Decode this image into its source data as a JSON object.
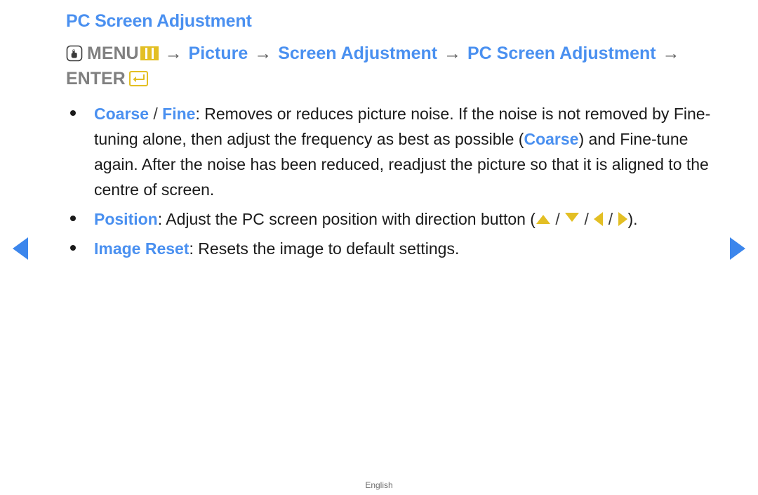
{
  "page": {
    "title": "PC Screen Adjustment",
    "footer_label": "English"
  },
  "menu_path": {
    "press_icon": "press-button-icon",
    "menu_label": "MENU",
    "menu_icon": "menu-bars-icon",
    "arrow": "→",
    "steps": [
      {
        "label": "Picture",
        "style": "blue"
      },
      {
        "label": "Screen Adjustment",
        "style": "blue"
      },
      {
        "label": "PC Screen Adjustment",
        "style": "blue"
      }
    ],
    "enter_label": "ENTER",
    "enter_icon": "enter-return-icon"
  },
  "bullets": [
    {
      "keyword_a": "Coarse",
      "separator": " / ",
      "keyword_b": "Fine",
      "colon": ": ",
      "text_1": "Removes or reduces picture noise. If the noise is not removed by Fine-tuning alone, then adjust the frequency as best as possible (",
      "inline_keyword": "Coarse",
      "text_2": ") and Fine-tune again. After the noise has been reduced, readjust the picture so that it is aligned to the centre of screen."
    },
    {
      "keyword_a": "Position",
      "colon": ": ",
      "text_1": "Adjust the PC screen position with direction button (",
      "dir_icons": [
        "arrow-up-icon",
        "arrow-down-icon",
        "arrow-left-icon",
        "arrow-right-icon"
      ],
      "dir_separator": " / ",
      "text_2": ")."
    },
    {
      "keyword_a": "Image Reset",
      "colon": ": ",
      "text_1": "Resets the image to default settings."
    }
  ],
  "navigation": {
    "prev_label": "previous-page",
    "next_label": "next-page"
  },
  "colors": {
    "accent_blue": "#4a90f0",
    "nav_blue": "#3c86ec",
    "gold": "#e3bf24",
    "gray_text": "#808080",
    "body_text": "#1a1a1a"
  }
}
